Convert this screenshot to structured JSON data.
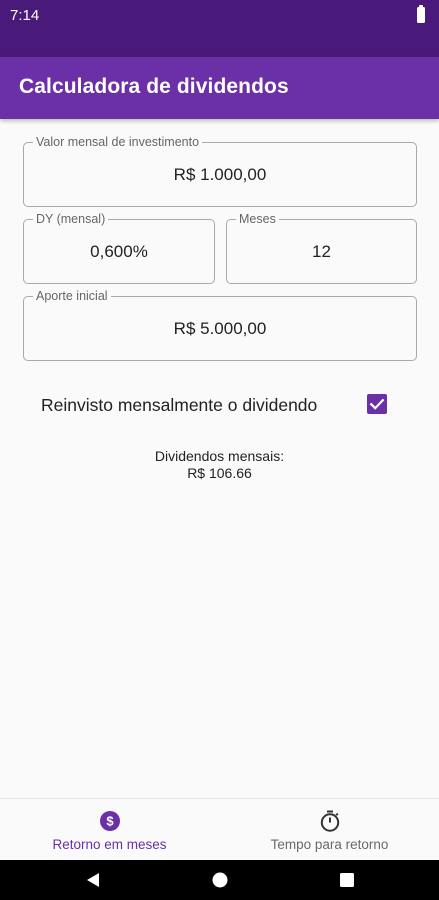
{
  "status_bar": {
    "time": "7:14",
    "icons": [
      "battery-icon"
    ]
  },
  "app_bar": {
    "title": "Calculadora de dividendos"
  },
  "form": {
    "valor_mensal": {
      "label": "Valor mensal de investimento",
      "value": "R$ 1.000,00"
    },
    "dy": {
      "label": "DY (mensal)",
      "value": "0,600%"
    },
    "meses": {
      "label": "Meses",
      "value": "12"
    },
    "aporte": {
      "label": "Aporte inicial",
      "value": "R$ 5.000,00"
    }
  },
  "reinvest": {
    "label": "Reinvisto mensalmente o dividendo",
    "checked": true
  },
  "result": {
    "title": "Dividendos mensais:",
    "value": "R$ 106.66"
  },
  "bottom_nav": {
    "items": [
      {
        "label": "Retorno em meses",
        "icon": "dollar-circle-icon",
        "active": true
      },
      {
        "label": "Tempo para retorno",
        "icon": "stopwatch-icon",
        "active": false
      }
    ]
  },
  "system_nav": {
    "buttons": [
      "back-icon",
      "home-icon",
      "recents-icon"
    ]
  },
  "colors": {
    "status_bar": "#4a1a7a",
    "primary": "#6b2fa8",
    "background": "#fafafa",
    "inactive_text": "#6a6a6a"
  }
}
